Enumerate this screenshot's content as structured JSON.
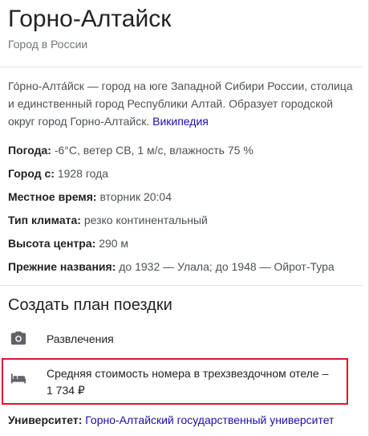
{
  "header": {
    "title": "Горно-Алтайск",
    "subtitle": "Город в России"
  },
  "description": {
    "text": "Го́рно-Алта́йск — город на юге Западной Сибири России, столица и единственный город Республики Алтай. Образует городской округ город Горно-Алтайск.",
    "source_link": "Википедия"
  },
  "facts": [
    {
      "key": "Погода:",
      "value": "-6°C, ветер СВ, 1 м/с, влажность 75 %"
    },
    {
      "key": "Город с:",
      "value": "1928 года"
    },
    {
      "key": "Местное время:",
      "value": "вторник 20:04"
    },
    {
      "key": "Тип климата:",
      "value": "резко континентальный"
    },
    {
      "key": "Высота центра:",
      "value": "290 м"
    },
    {
      "key": "Прежние названия:",
      "value": "до 1932 — Улала; до 1948 — Ойрот-Тура"
    }
  ],
  "trip": {
    "title": "Создать план поездки",
    "items": [
      {
        "icon": "camera-icon",
        "label": "Развлечения"
      },
      {
        "icon": "bed-icon",
        "label_line1": "Средняя стоимость номера в трехзвездочном отеле –",
        "label_line2": "1 734 ₽"
      }
    ]
  },
  "university": {
    "key": "Университет:",
    "value": "Горно-Алтайский государственный университет"
  },
  "colors": {
    "highlight": "#e0142e",
    "link": "#1a0dab",
    "muted": "#70757a"
  }
}
